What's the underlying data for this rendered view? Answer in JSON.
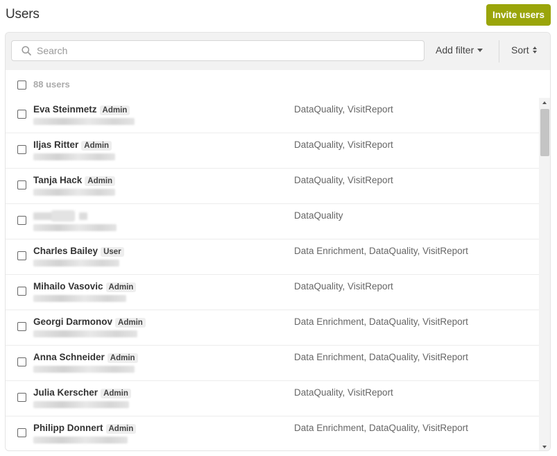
{
  "header": {
    "title": "Users",
    "invite_label": "Invite users",
    "accent_color": "#9aa50a"
  },
  "toolbar": {
    "search_placeholder": "Search",
    "search_value": "",
    "filter_label": "Add filter",
    "sort_label": "Sort"
  },
  "list": {
    "count_label": "88 users",
    "users": [
      {
        "name": "Eva Steinmetz",
        "role": "Admin",
        "modules": "DataQuality, VisitReport",
        "redacted": false
      },
      {
        "name": "Iljas Ritter",
        "role": "Admin",
        "modules": "DataQuality, VisitReport",
        "redacted": false
      },
      {
        "name": "Tanja Hack",
        "role": "Admin",
        "modules": "DataQuality, VisitReport",
        "redacted": false
      },
      {
        "name": "",
        "role": "",
        "modules": "DataQuality",
        "redacted": true
      },
      {
        "name": "Charles Bailey",
        "role": "User",
        "modules": "Data Enrichment, DataQuality, VisitReport",
        "redacted": false
      },
      {
        "name": "Mihailo Vasovic",
        "role": "Admin",
        "modules": "DataQuality, VisitReport",
        "redacted": false
      },
      {
        "name": "Georgi Darmonov",
        "role": "Admin",
        "modules": "Data Enrichment, DataQuality, VisitReport",
        "redacted": false
      },
      {
        "name": "Anna Schneider",
        "role": "Admin",
        "modules": "Data Enrichment, DataQuality, VisitReport",
        "redacted": false
      },
      {
        "name": "Julia Kerscher",
        "role": "Admin",
        "modules": "DataQuality, VisitReport",
        "redacted": false
      },
      {
        "name": "Philipp Donnert",
        "role": "Admin",
        "modules": "Data Enrichment, DataQuality, VisitReport",
        "redacted": false
      }
    ]
  }
}
